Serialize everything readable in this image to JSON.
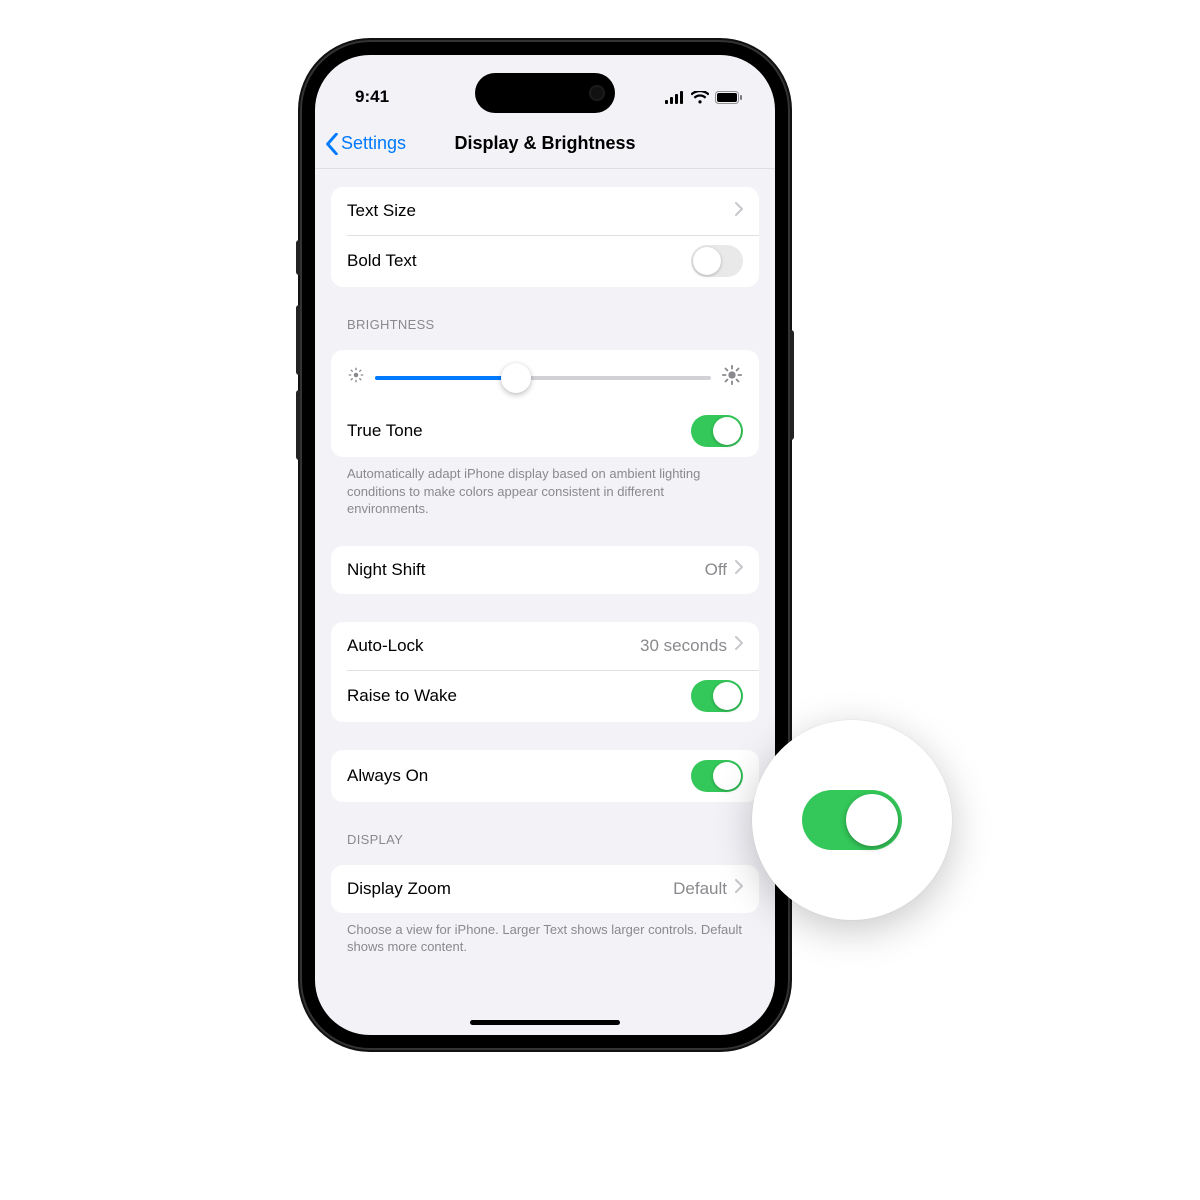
{
  "status": {
    "time": "9:41"
  },
  "nav": {
    "back": "Settings",
    "title": "Display & Brightness"
  },
  "textGroup": {
    "textSize": "Text Size",
    "boldText": "Bold Text",
    "boldTextOn": false
  },
  "brightness": {
    "header": "BRIGHTNESS",
    "percent": 42,
    "trueTone": "True Tone",
    "trueToneOn": true,
    "footer": "Automatically adapt iPhone display based on ambient lighting conditions to make colors appear consistent in different environments."
  },
  "nightShift": {
    "label": "Night Shift",
    "value": "Off"
  },
  "lock": {
    "autoLock": "Auto-Lock",
    "autoLockValue": "30 seconds",
    "raiseToWake": "Raise to Wake",
    "raiseToWakeOn": true
  },
  "alwaysOn": {
    "label": "Always On",
    "on": true
  },
  "display": {
    "header": "DISPLAY",
    "zoom": "Display Zoom",
    "zoomValue": "Default",
    "footer": "Choose a view for iPhone. Larger Text shows larger controls. Default shows more content."
  }
}
